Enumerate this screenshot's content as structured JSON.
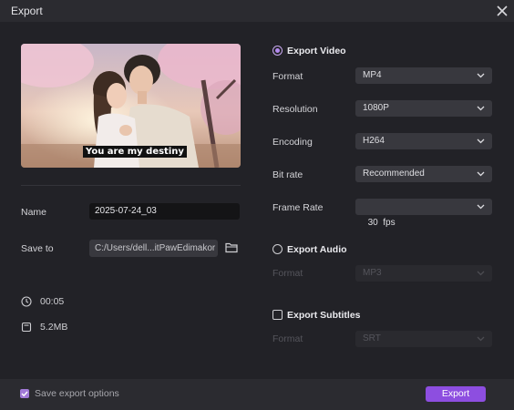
{
  "window": {
    "title": "Export"
  },
  "preview": {
    "caption": "You are my destiny"
  },
  "fields": {
    "name_label": "Name",
    "name_value": "2025-07-24_03",
    "save_to_label": "Save to",
    "save_to_value": "C:/Users/dell...itPawEdimakor"
  },
  "info": {
    "duration": "00:05",
    "size": "5.2MB"
  },
  "export_video": {
    "label": "Export Video",
    "selected": true,
    "format_label": "Format",
    "format_value": "MP4",
    "resolution_label": "Resolution",
    "resolution_value": "1080P",
    "encoding_label": "Encoding",
    "encoding_value": "H264",
    "bitrate_label": "Bit rate",
    "bitrate_value": "Recommended",
    "framerate_label": "Frame Rate",
    "framerate_value": "30  fps"
  },
  "export_audio": {
    "label": "Export Audio",
    "selected": false,
    "format_label": "Format",
    "format_value": "MP3"
  },
  "export_subtitles": {
    "label": "Export Subtitles",
    "checked": false,
    "format_label": "Format",
    "format_value": "SRT"
  },
  "footer": {
    "save_options_label": "Save export options",
    "save_options_checked": true,
    "export_button": "Export"
  },
  "colors": {
    "accent": "#8d4ee0",
    "radio_selected": "#b48af0",
    "background": "#222227",
    "panel": "#2b2b30",
    "dropdown": "#38383e"
  },
  "icons": [
    "close-icon",
    "folder-icon",
    "clock-icon",
    "file-size-icon",
    "chevron-down-icon",
    "check-icon"
  ]
}
